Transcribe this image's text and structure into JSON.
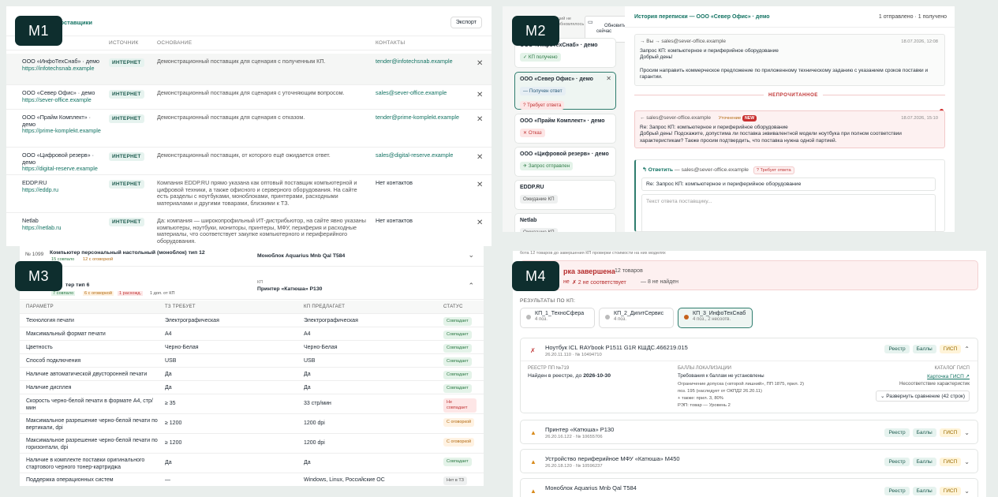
{
  "tags": {
    "m1": "M1",
    "m2": "M2",
    "m3": "M3",
    "m4": "M4"
  },
  "m1": {
    "title": "поставщики",
    "export_label": "Экспорт",
    "columns": [
      "ИСТОЧНИК",
      "ОСНОВАНИЕ",
      "КОНТАКТЫ"
    ],
    "rows": [
      {
        "name": "ООО «ИнфоТехСнаб» · демо",
        "url": "https://infotechsnab.example",
        "source": "ИНТЕРНЕТ",
        "basis": "Демонстрационный поставщик для сценария с полученным КП.",
        "contact": "tender@infotechsnab.example"
      },
      {
        "name": "ООО «Север Офис» · демо",
        "url": "https://sever-office.example",
        "source": "ИНТЕРНЕТ",
        "basis": "Демонстрационный поставщик для сценария с уточняющим вопросом.",
        "contact": "sales@sever-office.example"
      },
      {
        "name": "ООО «Прайм Комплект» · демо",
        "url": "https://prime-komplekt.example",
        "source": "ИНТЕРНЕТ",
        "basis": "Демонстрационный поставщик для сценария с отказом.",
        "contact": "tender@prime-komplekt.example"
      },
      {
        "name": "ООО «Цифровой резерв» · демо",
        "url": "https://digital-reserve.example",
        "source": "ИНТЕРНЕТ",
        "basis": "Демонстрационный поставщик, от которого ещё ожидается ответ.",
        "contact": "sales@digital-reserve.example"
      },
      {
        "name": "EDDP.RU",
        "url": "https://eddp.ru",
        "source": "ИНТЕРНЕТ",
        "basis": "Компания EDDP.RU прямо указана как оптовый поставщик компьютерной и цифровой техники, а также офисного и серверного оборудования. На сайте есть разделы с ноутбуками, моноблоками, принтерами, расходными материалами и другими товарами, близкими к ТЗ.",
        "contact": "Нет контактов"
      },
      {
        "name": "Netlab",
        "url": "https://netlab.ru",
        "source": "ИНТЕРНЕТ",
        "basis": "Да: компания — широкопрофильный ИТ-дистрибьютор, на сайте явно указаны компьютеры, ноутбуки, мониторы, принтеры, МФУ, периферия и расходные материалы, что соответствует закупке компьютерного и периферийного оборудования.",
        "contact": "Нет контактов"
      }
    ]
  },
  "m2": {
    "top_small": "ций не\nобновлялось",
    "refresh_label": "Обновить\nсейчас",
    "cards": [
      {
        "name": "ООО «ИнфоТехСнаб» · демо",
        "status": "✓ КП получено"
      },
      {
        "name": "ООО «Север Офис» · демо",
        "status": "— Получен ответ",
        "status2": "? Требует ответа"
      },
      {
        "name": "ООО «Прайм Комплект» · демо",
        "status": "✕ Отказ"
      },
      {
        "name": "ООО «Цифровой резерв» · демо",
        "status": "✈ Запрос отправлен"
      },
      {
        "name": "EDDP.RU",
        "status": "Ожидание КП"
      },
      {
        "name": "Netlab",
        "status": "Ожидание КП"
      }
    ],
    "history_title": "История переписки — ООО «Север Офис» · демо",
    "counts": "1 отправлено · 1 получено",
    "out_meta": "→ Вы → sales@sever-office.example",
    "out_date": "18.07.2026, 12:08",
    "out_subject": "Запрос КП: компьютерное и периферийное оборудование",
    "out_greet": "Добрый день!",
    "out_body": "Просим направить коммерческое предложение по приложенному техническому заданию с указанием сроков поставки и гарантии.",
    "unread": "НЕПРОЧИТАННОЕ",
    "in_meta": "← sales@sever-office.example",
    "in_tag": "Уточнение",
    "in_new": "NEW",
    "in_date": "18.07.2026, 15:10",
    "in_subject": "Re: Запрос КП: компьютерное и периферийное оборудование",
    "in_body": "Добрый день! Подскажите, допустима ли поставка эквивалентной модели ноутбука при полном соответствии характеристикам? Также просим подтвердить, что поставка нужна одной партией.",
    "reply_label": "↰ Ответить",
    "reply_to": "— sales@sever-office.example",
    "reply_badge": "? Требует ответа",
    "reply_subject": "Re: Запрос КП: компьютерное и периферийное оборудование",
    "reply_placeholder": "Текст ответа поставщику..."
  },
  "m3": {
    "top_num": "№ 1099",
    "top_name": "Компьютер персональный настольный (моноблок) тип 12",
    "top_ok": "15 совпало",
    "top_warn": "12 с оговоркой",
    "top_offer": "Моноблок Aquarius Mnb Qal T584",
    "hdr_name": "тер тип 6",
    "hdr_ok": "7 совпало",
    "hdr_warn": "6 с оговоркой",
    "hdr_bad": "1 расхожд.",
    "hdr_extra": "1 доп. от КП",
    "hdr_kp_label": "КП",
    "hdr_offer": "Принтер «Катюша» P130",
    "columns": [
      "ПАРАМЕТР",
      "ТЗ ТРЕБУЕТ",
      "КП ПРЕДЛАГАЕТ",
      "СТАТУС"
    ],
    "rows": [
      {
        "p": "Технология печати",
        "t": "Электрографическая",
        "k": "Электрографическая",
        "s": "Совпадает",
        "c": "ok"
      },
      {
        "p": "Максимальный формат печати",
        "t": "A4",
        "k": "A4",
        "s": "Совпадает",
        "c": "ok"
      },
      {
        "p": "Цветность",
        "t": "Черно-Белая",
        "k": "Черно-Белая",
        "s": "Совпадает",
        "c": "ok"
      },
      {
        "p": "Способ подключения",
        "t": "USB",
        "k": "USB",
        "s": "Совпадает",
        "c": "ok"
      },
      {
        "p": "Наличие автоматической двусторонней печати",
        "t": "Да",
        "k": "Да",
        "s": "Совпадает",
        "c": "ok"
      },
      {
        "p": "Наличие дисплея",
        "t": "Да",
        "k": "Да",
        "s": "Совпадает",
        "c": "ok"
      },
      {
        "p": "Скорость черно-белой печати в формате А4, стр/мин",
        "t": "≥ 35",
        "k": "33 стр/мин",
        "s": "Не совпадает",
        "c": "bad"
      },
      {
        "p": "Максимальное разрешение черно-белой печати по вертикали, dpi",
        "t": "≥ 1200",
        "k": "1200 dpi",
        "s": "С оговоркой",
        "c": "warn"
      },
      {
        "p": "Максимальное разрешение черно-белой печати по горизонтали, dpi",
        "t": "≥ 1200",
        "k": "1200 dpi",
        "s": "С оговоркой",
        "c": "warn"
      },
      {
        "p": "Наличие в комплекте поставки оригинального стартового черного тонер-картриджа",
        "t": "Да",
        "k": "Да",
        "s": "Совпадает",
        "c": "ok"
      },
      {
        "p": "Поддержка операционных систем",
        "t": "—",
        "k": "Windows, Linux, Российские ОС",
        "s": "Нет в ТЗ",
        "c": "grey"
      }
    ]
  },
  "m4": {
    "top_cut": "бота 12 товаров до завершения КП проверки стоимости на них моделях",
    "status_title": "рка завершена",
    "status_count": "12 товаров",
    "status_ne": "не",
    "status_mismatch": "✗ 2 не соответствует",
    "status_notfound": "— 8 не найден",
    "results_label": "РЕЗУЛЬТАТЫ ПО КП:",
    "kps": [
      {
        "name": "КП_1_ТехноСфера",
        "sub": "4 поз."
      },
      {
        "name": "КП_2_ДигитСервис",
        "sub": "4 поз."
      },
      {
        "name": "КП_3_ИнфоТехСнаб",
        "sub": "4 поз., 2 несоотв."
      }
    ],
    "item1": {
      "name": "Ноутбук ICL RAYbook P1511 G1R КШДС.466219.015",
      "sub": "26.20.11.110 · № 10494710",
      "reg": "Реестр",
      "pts": "Баллы",
      "gisp": "ГИСП",
      "reg_label": "РЕЕСТР ПП №719",
      "reg_found": "Найден в реестре, до",
      "reg_date": "2026-10-30",
      "pts_label": "БАЛЛЫ ЛОКАЛИЗАЦИИ",
      "pts_line1": "Требования к баллам не установлены",
      "pts_line2": "Ограничение допуска («второй лишний», ПП 1875, прил. 2)",
      "pts_line3": "поз. 195 (наследует от ОКПД2 26.20.11)",
      "pts_line4": "+ также: прил. 3, 80%",
      "pts_line5": "РЭП: товар — Уровень 2",
      "cat_label": "КАТАЛОГ ГИСП",
      "cat_link": "Карточка ГИСП ↗",
      "cat_note": "Несоответствие характеристик",
      "expand": "⌄ Развернуть сравнение (42 строк)"
    },
    "items": [
      {
        "name": "Принтер «Катюша» P130",
        "sub": "26.20.16.122 · № 10655706",
        "reg": "Реестр",
        "pts": "Баллы",
        "gisp": "ГИСП"
      },
      {
        "name": "Устройство периферийное МФУ «Катюша» M450",
        "sub": "26.20.18.120 · № 10596237",
        "reg": "Реестр",
        "pts": "Баллы",
        "gisp": "ГИСП"
      },
      {
        "name": "Моноблок Aquarius Mnb Qal T584",
        "sub": "",
        "reg": "Реестр",
        "pts": "Баллы",
        "gisp": "ГИСП"
      }
    ]
  },
  "colors": {
    "accent": "#137363",
    "tag_bg": "#0e2e2e",
    "unread": "#c03535"
  }
}
